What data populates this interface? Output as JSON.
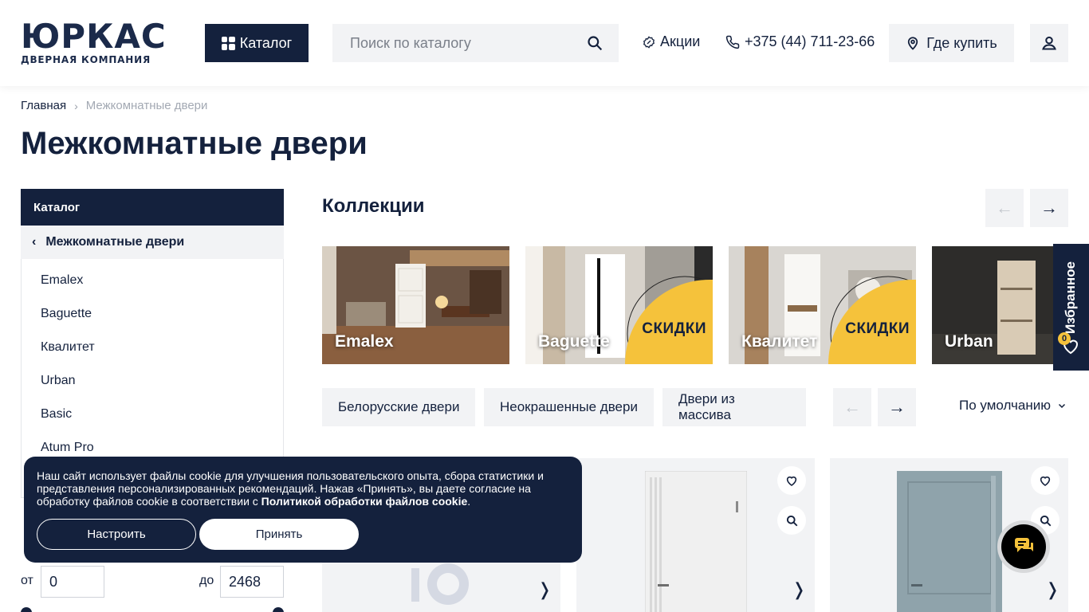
{
  "header": {
    "logo_main": "ЮРКАС",
    "logo_sub": "ДВЕРНАЯ КОМПАНИЯ",
    "catalog_label": "Каталог",
    "search_placeholder": "Поиск по каталогу",
    "promo_label": "Акции",
    "phone": "+375 (44) 711-23-66",
    "where_to_buy": "Где купить"
  },
  "breadcrumb": {
    "home": "Главная",
    "current": "Межкомнатные двери"
  },
  "page_title": "Межкомнатные двери",
  "sidebar": {
    "heading": "Каталог",
    "parent": "Межкомнатные двери",
    "items": [
      "Emalex",
      "Baguette",
      "Квалитет",
      "Urban",
      "Basic",
      "Atum Pro"
    ]
  },
  "price": {
    "from_label": "от",
    "to_label": "до",
    "from_value": "0",
    "to_value": "2468"
  },
  "collections": {
    "title": "Коллекции",
    "cards": [
      {
        "label": "Emalex",
        "sale": ""
      },
      {
        "label": "Baguette",
        "sale": "СКИДКИ"
      },
      {
        "label": "Квалитет",
        "sale": "СКИДКИ"
      },
      {
        "label": "Urban",
        "sale": ""
      }
    ]
  },
  "tags": [
    "Белорусские двери",
    "Неокрашенные двери",
    "Двери из массива"
  ],
  "sort_label": "По умолчанию",
  "favorites": {
    "label": "Избранное",
    "count": "0"
  },
  "cookie": {
    "text": "Наш сайт использует файлы cookie для улучшения пользовательского опыта, сбора статистики и представления персонализированных рекомендаций. Нажав «Принять», вы даете согласие на обработку файлов cookie в соответствии с ",
    "link": "Политикой обработки файлов cookie",
    "text_end": ".",
    "configure": "Настроить",
    "accept": "Принять"
  },
  "colors": {
    "primary": "#14213d",
    "accent": "#f5c23b",
    "light_bg": "#f2f3f5"
  }
}
